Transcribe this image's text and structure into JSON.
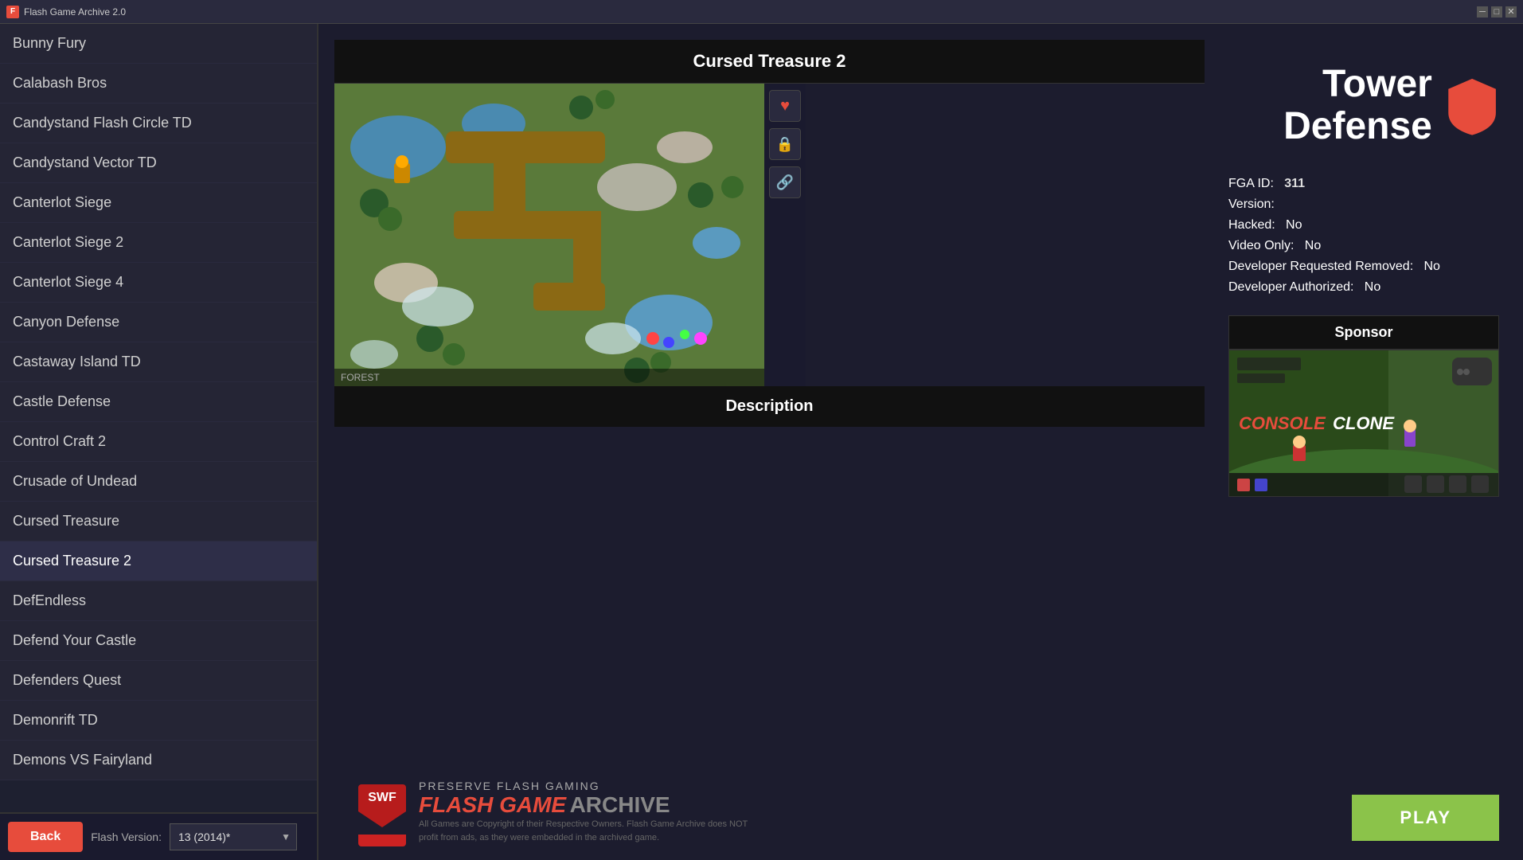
{
  "app": {
    "title": "Flash Game Archive 2.0"
  },
  "sidebar": {
    "items": [
      {
        "label": "Bunny Fury",
        "id": "bunny-fury"
      },
      {
        "label": "Calabash Bros",
        "id": "calabash-bros"
      },
      {
        "label": "Candystand Flash Circle TD",
        "id": "candystand-flash-circle-td"
      },
      {
        "label": "Candystand Vector TD",
        "id": "candystand-vector-td"
      },
      {
        "label": "Canterlot Siege",
        "id": "canterlot-siege"
      },
      {
        "label": "Canterlot Siege 2",
        "id": "canterlot-siege-2"
      },
      {
        "label": "Canterlot Siege 4",
        "id": "canterlot-siege-4"
      },
      {
        "label": "Canyon Defense",
        "id": "canyon-defense"
      },
      {
        "label": "Castaway Island TD",
        "id": "castaway-island-td"
      },
      {
        "label": "Castle Defense",
        "id": "castle-defense"
      },
      {
        "label": "Control Craft 2",
        "id": "control-craft-2"
      },
      {
        "label": "Crusade of Undead",
        "id": "crusade-of-undead"
      },
      {
        "label": "Cursed Treasure",
        "id": "cursed-treasure"
      },
      {
        "label": "Cursed Treasure 2",
        "id": "cursed-treasure-2",
        "active": true
      },
      {
        "label": "DefEndless",
        "id": "def-endless"
      },
      {
        "label": "Defend Your Castle",
        "id": "defend-your-castle"
      },
      {
        "label": "Defenders Quest",
        "id": "defenders-quest"
      },
      {
        "label": "Demonrift TD",
        "id": "demonrift-td"
      },
      {
        "label": "Demons VS Fairyland",
        "id": "demons-vs-fairyland"
      }
    ],
    "back_button": "Back",
    "flash_version_label": "Flash Version:",
    "flash_version_value": "13 (2014)*"
  },
  "game": {
    "title": "Cursed Treasure 2",
    "description_label": "Description",
    "description_text": "",
    "fga_id": "311",
    "version": "",
    "hacked": "No",
    "video_only": "No",
    "developer_requested_removed": "No",
    "developer_authorized": "No",
    "map_label": "FOREST",
    "thumbnail_alt": "Cursed Treasure 2 gameplay screenshot"
  },
  "sidebar_right": {
    "category_title": "Tower Defense",
    "meta": {
      "fga_id_label": "FGA ID:",
      "version_label": "Version:",
      "hacked_label": "Hacked:",
      "video_only_label": "Video Only:",
      "dev_removed_label": "Developer Requested Removed:",
      "dev_authorized_label": "Developer Authorized:"
    }
  },
  "sponsor": {
    "label": "Sponsor",
    "name": "CONSOLE CLONE",
    "image_alt": "Console Clone sponsor image"
  },
  "footer": {
    "preserve_text": "PRESERVE FLASH GAMING",
    "brand_red": "FLASH GAME",
    "brand_gray": "ARCHIVE",
    "copyright": "All Games are Copyright of their Respective Owners. Flash Game Archive does NOT profit from ads, as they were embedded in the archived game.",
    "play_button": "PLAY"
  },
  "icons": {
    "heart": "♥",
    "lock": "🔒",
    "link": "🔗",
    "shield": "shield"
  }
}
